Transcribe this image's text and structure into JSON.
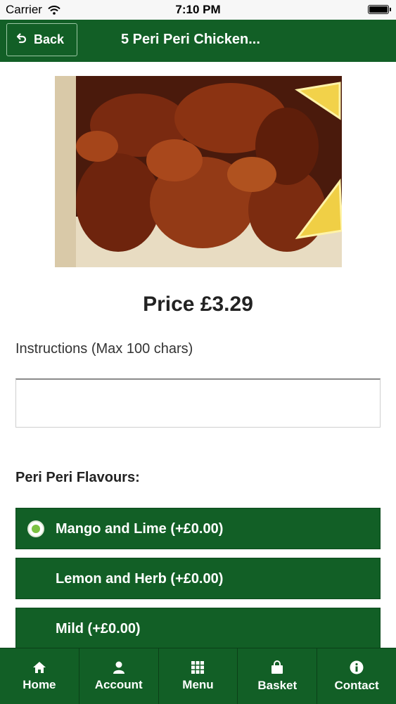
{
  "status_bar": {
    "carrier": "Carrier",
    "time": "7:10 PM"
  },
  "header": {
    "back_label": "Back",
    "title": "5 Peri Peri Chicken..."
  },
  "product": {
    "price": "Price £3.29",
    "instructions_label": "Instructions (Max 100 chars)",
    "instructions_value": "",
    "flavours_label": "Peri Peri Flavours:",
    "options": [
      {
        "label": "Mango and Lime (+£0.00)",
        "selected": true
      },
      {
        "label": "Lemon and Herb (+£0.00)",
        "selected": false
      },
      {
        "label": "Mild (+£0.00)",
        "selected": false
      }
    ]
  },
  "tabs": [
    {
      "label": "Home",
      "icon": "home-icon"
    },
    {
      "label": "Account",
      "icon": "user-icon"
    },
    {
      "label": "Menu",
      "icon": "grid-icon"
    },
    {
      "label": "Basket",
      "icon": "bag-icon"
    },
    {
      "label": "Contact",
      "icon": "info-icon"
    }
  ],
  "colors": {
    "brand_green": "#125f26",
    "radio_selected": "#7cc242"
  }
}
